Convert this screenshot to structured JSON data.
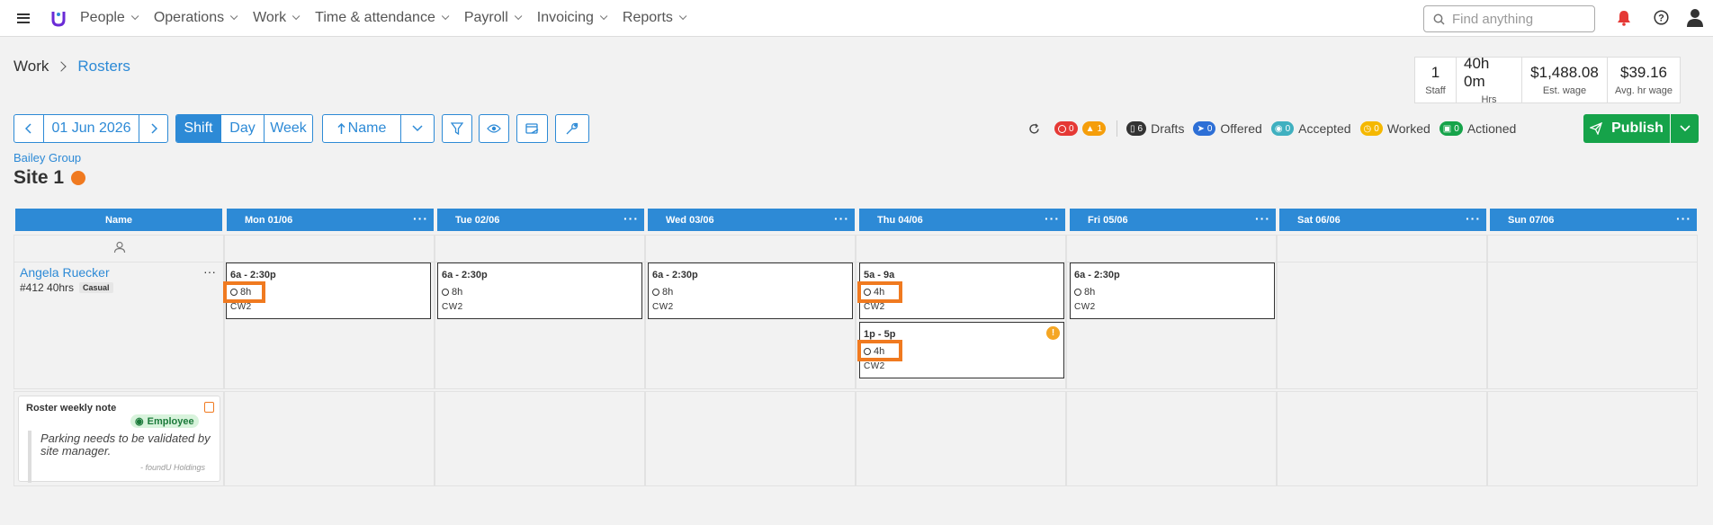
{
  "nav": {
    "items": [
      "People",
      "Operations",
      "Work",
      "Time & attendance",
      "Payroll",
      "Invoicing",
      "Reports"
    ],
    "search_placeholder": "Find anything"
  },
  "breadcrumb": {
    "parent": "Work",
    "current": "Rosters"
  },
  "stats": [
    {
      "value": "1",
      "label": "Staff"
    },
    {
      "value": "40h 0m",
      "label": "Hrs"
    },
    {
      "value": "$1,488.08",
      "label": "Est. wage"
    },
    {
      "value": "$39.16",
      "label": "Avg. hr wage"
    }
  ],
  "toolbar": {
    "date": "01 Jun 2026",
    "views": [
      "Shift",
      "Day",
      "Week"
    ],
    "active_view": "Shift",
    "sort_label": "Name"
  },
  "statuses": {
    "errors": "0",
    "warnings": "1",
    "drafts_count": "6",
    "drafts_label": "Drafts",
    "offered_count": "0",
    "offered_label": "Offered",
    "accepted_count": "0",
    "accepted_label": "Accepted",
    "worked_count": "0",
    "worked_label": "Worked",
    "actioned_count": "0",
    "actioned_label": "Actioned"
  },
  "publish_label": "Publish",
  "org": "Bailey Group",
  "site": "Site 1",
  "grid": {
    "name_header": "Name",
    "days": [
      "Mon 01/06",
      "Tue 02/06",
      "Wed 03/06",
      "Thu 04/06",
      "Fri 05/06",
      "Sat 06/06",
      "Sun 07/06"
    ]
  },
  "employee": {
    "name": "Angela Ruecker",
    "meta": "#412 40hrs",
    "type": "Casual"
  },
  "shifts": [
    {
      "time": "6a - 2:30p",
      "hours": "8h",
      "code": "CW2"
    },
    {
      "time": "6a - 2:30p",
      "hours": "8h",
      "code": "CW2"
    },
    {
      "time": "6a - 2:30p",
      "hours": "8h",
      "code": "CW2"
    },
    {
      "time": "5a - 9a",
      "hours": "4h",
      "code": "CW2"
    },
    {
      "time": "1p - 5p",
      "hours": "4h",
      "code": "CW2"
    },
    {
      "time": "6a - 2:30p",
      "hours": "8h",
      "code": "CW2"
    }
  ],
  "note": {
    "title": "Roster weekly note",
    "badge": "Employee",
    "text": "Parking needs to be validated by site manager.",
    "author": "- foundU Holdings"
  },
  "colors": {
    "primary": "#2d8ad6",
    "publish": "#16a34a",
    "highlight": "#f07a20"
  }
}
